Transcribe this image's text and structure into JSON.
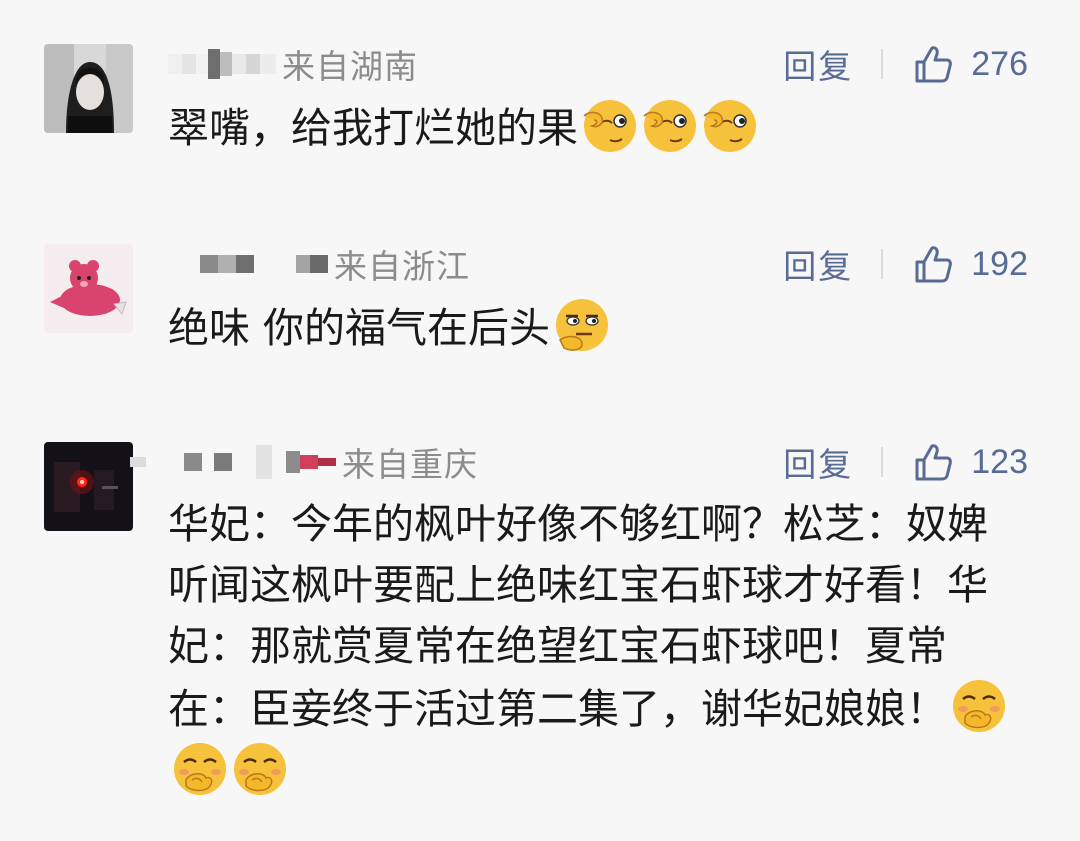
{
  "comments": [
    {
      "location": "来自湖南",
      "reply_label": "回复",
      "likes": "276",
      "text": "翠嘴，给我打烂她的果",
      "emoji_names": [
        "wink-ok-emoji",
        "wink-ok-emoji",
        "wink-ok-emoji"
      ]
    },
    {
      "location": "来自浙江",
      "reply_label": "回复",
      "likes": "192",
      "text": "绝味 你的福气在后头",
      "emoji_names": [
        "smirk-thinking-emoji"
      ]
    },
    {
      "location": "来自重庆",
      "reply_label": "回复",
      "likes": "123",
      "text": "华妃：今年的枫叶好像不够红啊？松芝：奴婢听闻这枫叶要配上绝味红宝石虾球才好看！华妃：那就赏夏常在绝望红宝石虾球吧！夏常在：臣妾终于活过第二集了，谢华妃娘娘！",
      "emoji_names": [
        "giggle-emoji",
        "giggle-emoji",
        "giggle-emoji"
      ]
    }
  ],
  "colors": {
    "background": "#f7f7f7",
    "link_blue": "#576b95",
    "location_gray": "#8c8c8c",
    "text": "#1a1a1a"
  }
}
